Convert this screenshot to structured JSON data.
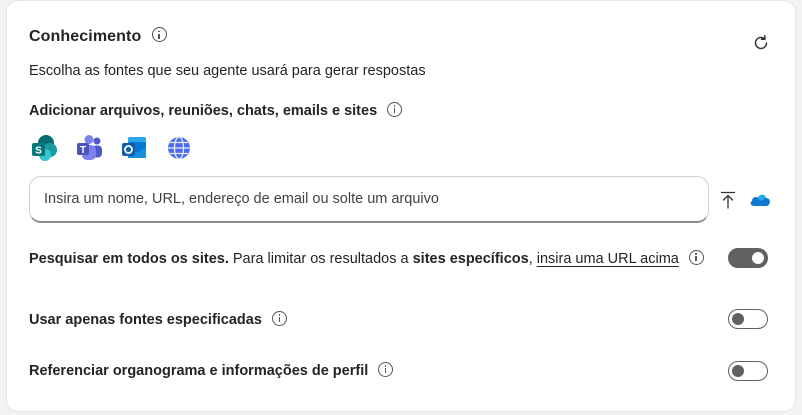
{
  "header": {
    "title": "Conhecimento",
    "subtitle": "Escolha as fontes que seu agente usará para gerar respostas"
  },
  "sources": {
    "heading": "Adicionar arquivos, reuniões, chats, emails e sites",
    "apps": [
      "sharepoint-icon",
      "teams-icon",
      "outlook-icon",
      "web-globe-icon"
    ]
  },
  "input": {
    "placeholder": "Insira um nome, URL, endereço de email ou solte um arquivo",
    "value": ""
  },
  "settings": {
    "search_all": {
      "bold_label": "Pesquisar em todos os sites.",
      "text_mid": " Para limitar os resultados a ",
      "bold_specific": "sites específicos",
      "text_comma": ", ",
      "link": "insira uma URL acima",
      "enabled": true
    },
    "only_specified": {
      "label": "Usar apenas fontes especificadas",
      "enabled": false
    },
    "org_chart": {
      "label": "Referenciar organograma e informações de perfil",
      "enabled": false
    }
  },
  "colors": {
    "toggle_on": "#616161",
    "sharepoint": "#036c70",
    "teams": "#5059c9",
    "outlook": "#0f78d4",
    "globe": "#4f6bed",
    "onedrive": "#0f78d4"
  }
}
